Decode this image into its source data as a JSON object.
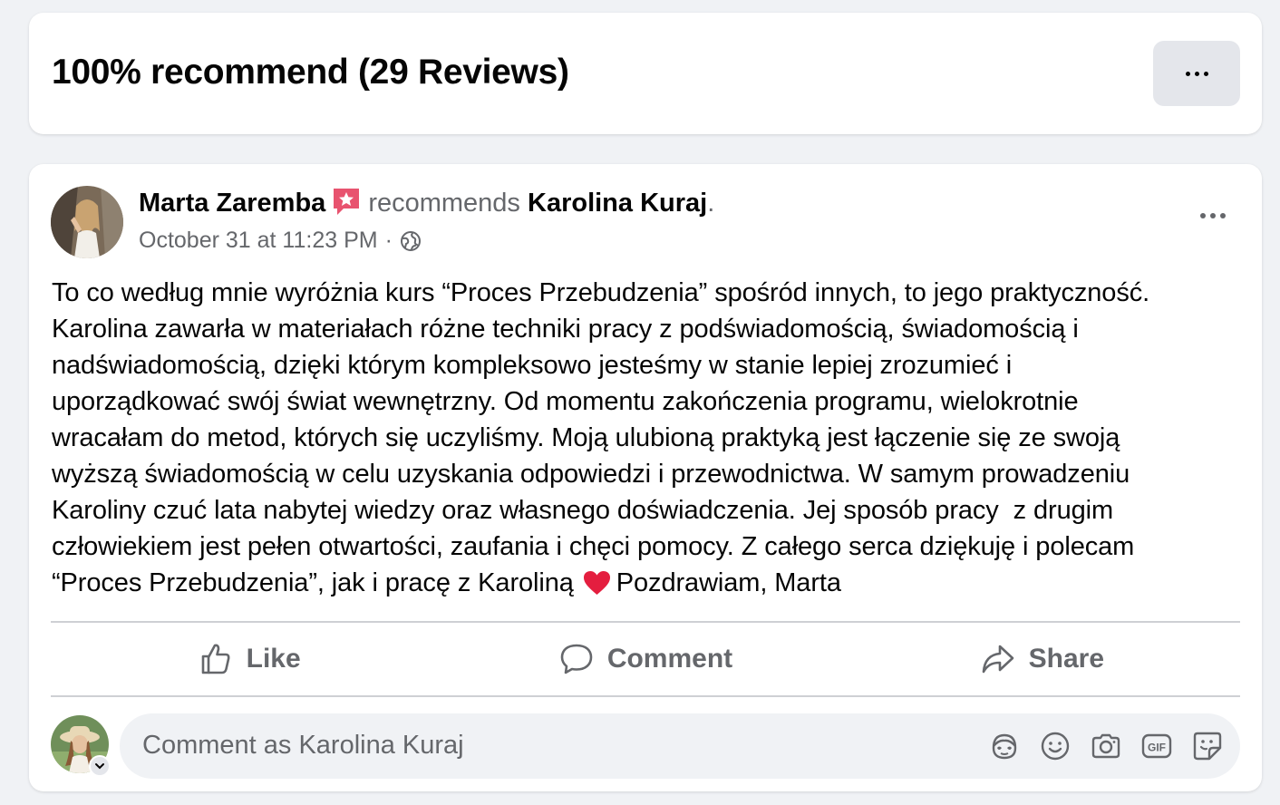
{
  "header": {
    "title": "100% recommend (29 Reviews)",
    "more_icon": "more-horizontal-icon"
  },
  "post": {
    "author": "Marta Zaremba",
    "recommends_word": "recommends",
    "target": "Karolina Kuraj",
    "period": ".",
    "timestamp": "October 31 at 11:23 PM",
    "separator": "·",
    "privacy_icon": "globe-icon",
    "badge_icon": "recommendation-star-icon",
    "text_lines": [
      "To co według mnie wyróżnia kurs “Proces Przebudzenia” spośród innych, to jego praktyczność.",
      "Karolina zawarła w materiałach różne techniki pracy z podświadomością, świadomością i",
      "nadświadomością, dzięki którym kompleksowo jesteśmy w stanie lepiej zrozumieć i",
      "uporządkować swój świat wewnętrzny. Od momentu zakończenia programu, wielokrotnie",
      "wracałam do metod, których się uczyliśmy. Moją ulubioną praktyką jest łączenie się ze swoją",
      "wyższą świadomością w celu uzyskania odpowiedzi i przewodnictwa. W samym prowadzeniu",
      "Karoliny czuć lata nabytej wiedzy oraz własnego doświadczenia. Jej sposób pracy  z drugim",
      "człowiekiem jest pełen otwartości, zaufania i chęci pomocy. Z całego serca dziękuję i polecam"
    ],
    "last_line_before": "“Proces Przebudzenia”, jak i pracę z Karoliną",
    "last_line_after": "Pozdrawiam, Marta",
    "emoji": "red-heart-icon"
  },
  "actions": {
    "like": "Like",
    "comment": "Comment",
    "share": "Share"
  },
  "composer": {
    "placeholder": "Comment as Karolina Kuraj",
    "icons": [
      "avatar-sticker-icon",
      "emoji-icon",
      "camera-icon",
      "gif-icon",
      "sticker-icon"
    ]
  },
  "colors": {
    "background": "#f0f2f5",
    "card": "#ffffff",
    "secondary_text": "#65676b",
    "primary_text": "#050505",
    "heart": "#e41e3f",
    "badge": "#e8536f"
  }
}
